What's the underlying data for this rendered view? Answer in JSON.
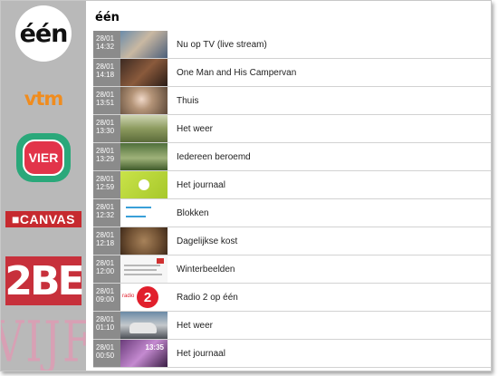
{
  "sidebar": {
    "channels": [
      {
        "id": "een",
        "logo_text": "één"
      },
      {
        "id": "vtm",
        "logo_text": "vtm"
      },
      {
        "id": "vier",
        "logo_text": "VIER"
      },
      {
        "id": "canvas",
        "logo_text": "■CANVAS"
      },
      {
        "id": "2be",
        "logo_text": "2BE"
      },
      {
        "id": "vijf",
        "logo_text": "VIJF"
      }
    ]
  },
  "main": {
    "channel_title": "één",
    "programs": [
      {
        "date": "28/01",
        "time": "14:32",
        "title": "Nu op TV (live stream)"
      },
      {
        "date": "28/01",
        "time": "14:18",
        "title": "One Man and His Campervan"
      },
      {
        "date": "28/01",
        "time": "13:51",
        "title": "Thuis"
      },
      {
        "date": "28/01",
        "time": "13:30",
        "title": "Het weer"
      },
      {
        "date": "28/01",
        "time": "13:29",
        "title": "Iedereen beroemd"
      },
      {
        "date": "28/01",
        "time": "12:59",
        "title": "Het journaal"
      },
      {
        "date": "28/01",
        "time": "12:32",
        "title": "Blokken"
      },
      {
        "date": "28/01",
        "time": "12:18",
        "title": "Dagelijkse kost"
      },
      {
        "date": "28/01",
        "time": "12:00",
        "title": "Winterbeelden"
      },
      {
        "date": "28/01",
        "time": "09:00",
        "title": "Radio 2 op één"
      },
      {
        "date": "28/01",
        "time": "01:10",
        "title": "Het weer"
      },
      {
        "date": "28/01",
        "time": "00:50",
        "title": "Het journaal"
      }
    ]
  },
  "thumbs": {
    "radio2_numeral": "2",
    "radio2_tag": "radio",
    "journaal_clock": "13:35"
  },
  "colors": {
    "sidebar_bg": "#b9b9b9",
    "time_bg": "#8b8b8b",
    "vtm_orange": "#f08c1e",
    "canvas_red": "#c62a2f",
    "2be_red": "#c7303b"
  }
}
